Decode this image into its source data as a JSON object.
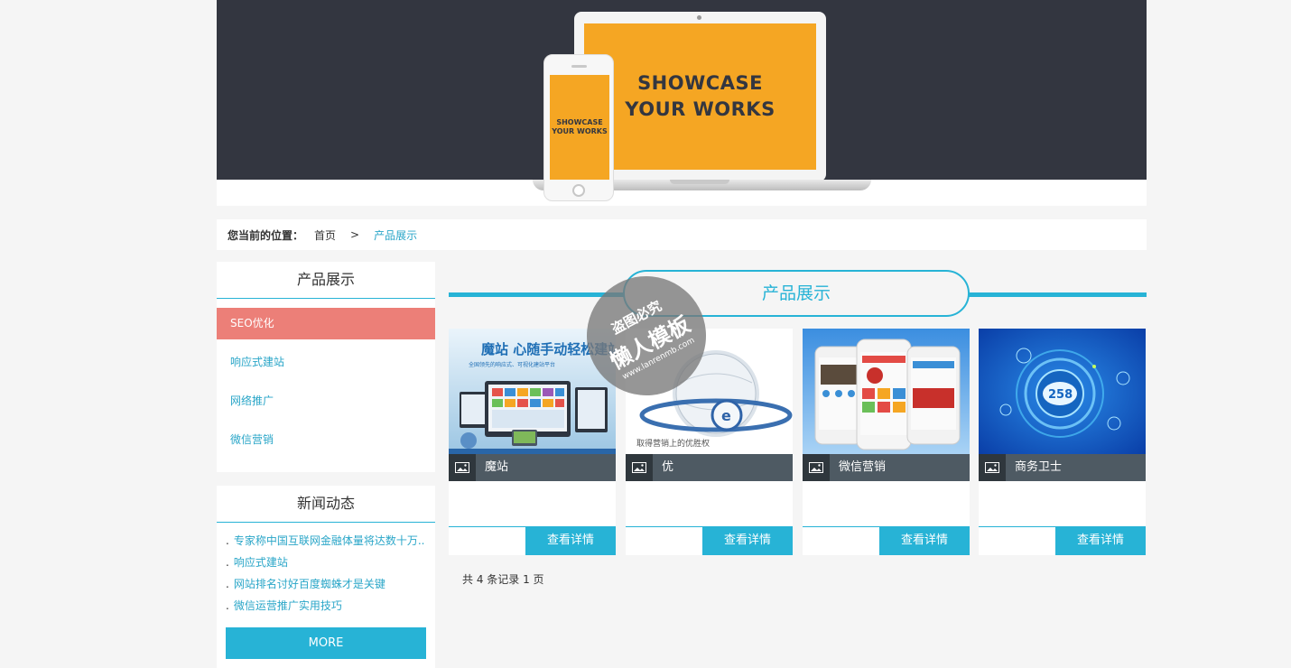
{
  "banner": {
    "laptop_line1": "SHOWCASE",
    "laptop_line2": "YOUR WORKS",
    "phone_line1": "SHOWCASE",
    "phone_line2": "YOUR WORKS"
  },
  "breadcrumb": {
    "label": "您当前的位置：",
    "home": "首页",
    "separator": ">",
    "current": "产品展示"
  },
  "sidebar": {
    "products_title": "产品展示",
    "items": [
      {
        "label": "SEO优化",
        "active": true
      },
      {
        "label": "响应式建站",
        "active": false
      },
      {
        "label": "网络推广",
        "active": false
      },
      {
        "label": "微信营销",
        "active": false
      }
    ],
    "news_title": "新闻动态",
    "news": [
      "专家称中国互联网金融体量将达数十万..",
      "响应式建站",
      "网站排名讨好百度蜘蛛才是关键",
      "微信运营推广实用技巧"
    ],
    "more_label": "MORE"
  },
  "main": {
    "title": "产品展示",
    "products": [
      {
        "name": "魔站",
        "button": "查看详情",
        "img_text": "魔站 心随手动轻松建站",
        "img_sub": "全国领先的响应式、可视化建站平台"
      },
      {
        "name": "优",
        "button": "查看详情",
        "img_text": "取得营销上的优胜权"
      },
      {
        "name": "微信营销",
        "button": "查看详情"
      },
      {
        "name": "商务卫士",
        "button": "查看详情",
        "img_text": "258"
      }
    ],
    "pager": "共 4 条记录 1 页"
  },
  "watermark": {
    "line1": "盗图必究",
    "line2": "懒人模板",
    "line3": "www.lanrenmb.com"
  },
  "colors": {
    "accent": "#27b3d6",
    "active_item": "#ec7f78",
    "banner_dark": "#333640",
    "screen_orange": "#f5a623",
    "card_bar": "#4e5a63"
  }
}
